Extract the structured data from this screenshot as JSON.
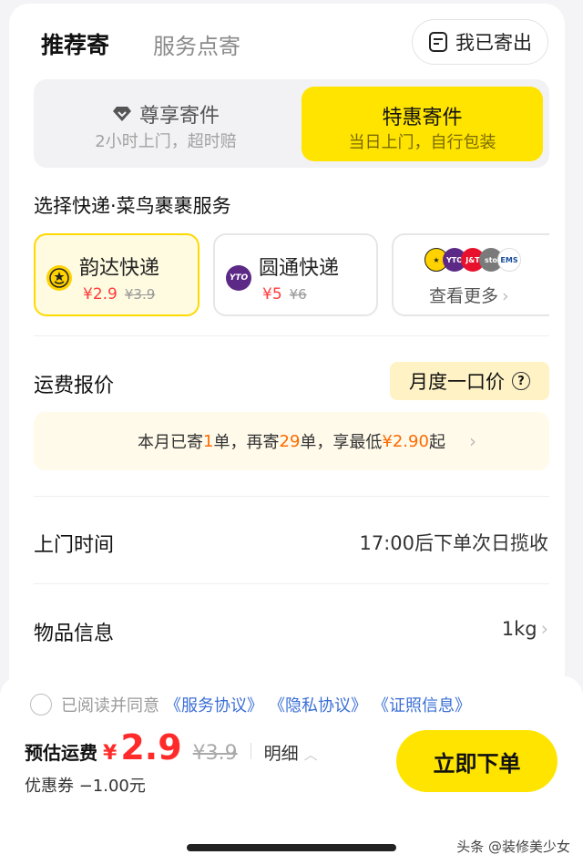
{
  "tabs": {
    "active": "推荐寄",
    "inactive": "服务点寄",
    "sent_button": "我已寄出"
  },
  "mode": {
    "premium": {
      "title": "尊享寄件",
      "desc": "2小时上门，超时赔"
    },
    "discount": {
      "title": "特惠寄件",
      "desc": "当日上门，自行包装"
    }
  },
  "courier_section": {
    "title": "选择快递·菜鸟裹裹服务",
    "items": [
      {
        "name": "韵达快递",
        "price": "¥2.9",
        "old_price": "¥3.9",
        "selected": true
      },
      {
        "name": "圆通快递",
        "price": "¥5",
        "old_price": "¥6",
        "selected": false
      }
    ],
    "more_label": "查看更多",
    "more_logos": [
      "YTO",
      "J&T",
      "sto",
      "EMS"
    ]
  },
  "freight": {
    "label": "运费报价",
    "tag": "月度一口价",
    "promo_prefix": "本月已寄",
    "promo_sent": "1",
    "promo_mid1": "单，再寄",
    "promo_more": "29",
    "promo_mid2": "单，享最低",
    "promo_price": "¥2.90",
    "promo_suffix": "起"
  },
  "pickup": {
    "label": "上门时间",
    "value": "17:00后下单次日揽收"
  },
  "item_info": {
    "label": "物品信息",
    "value": "1kg"
  },
  "agreement": {
    "text": "已阅读并同意",
    "links": [
      "《服务协议》",
      "《隐私协议》",
      "《证照信息》"
    ]
  },
  "summary": {
    "label": "预估运费",
    "currency": "¥",
    "amount": "2.9",
    "old_amount": "¥3.9",
    "detail": "明细",
    "coupon": "优惠券 −1.00元",
    "submit": "立即下单"
  },
  "watermark": "头条 @装修美少女",
  "colors": {
    "accent": "#ffe400",
    "price": "#ff2b2b",
    "link": "#3b6fd6"
  }
}
